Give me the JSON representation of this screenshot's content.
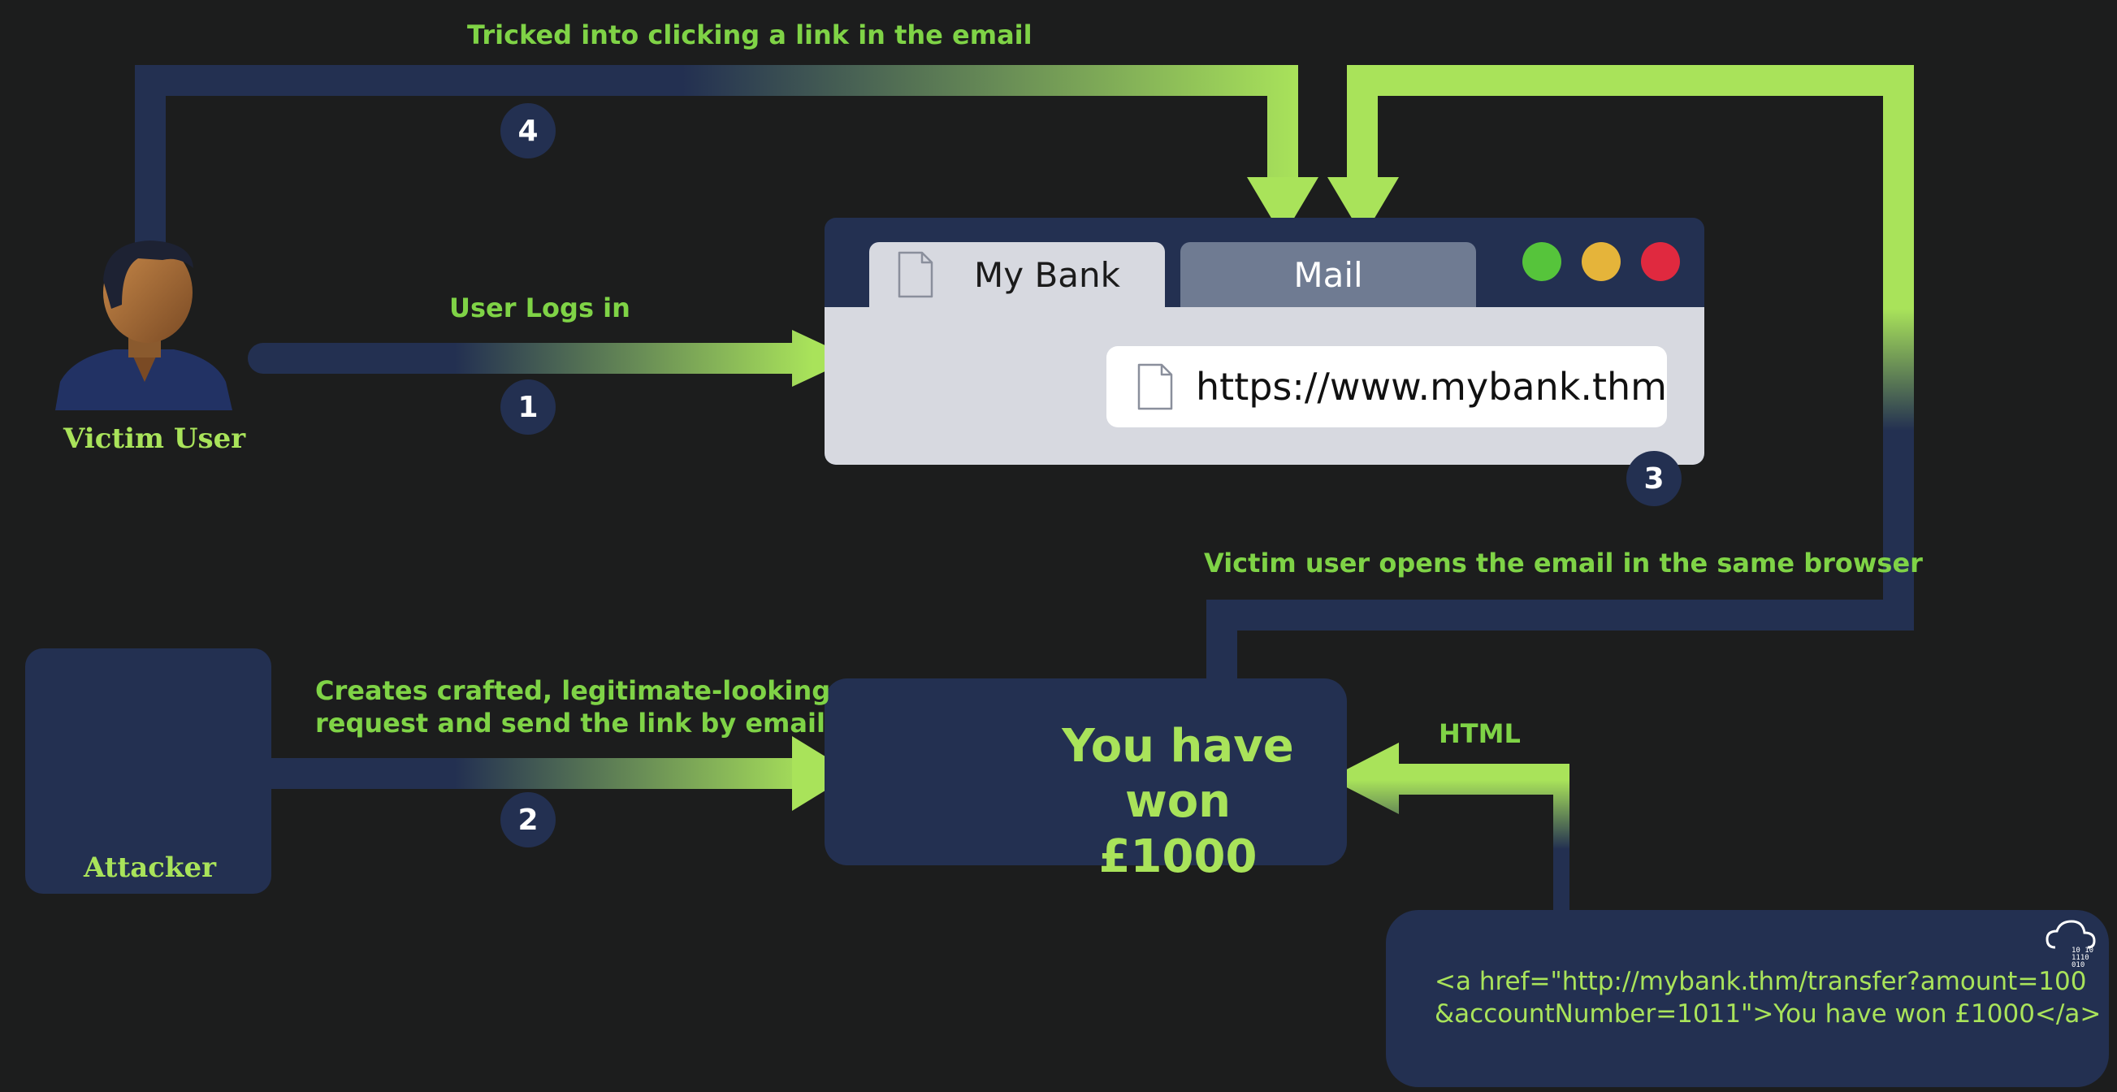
{
  "labels": {
    "step4": "Tricked into clicking a link in the email",
    "step1": "User Logs in",
    "step3": "Victim user opens the email in the same browser",
    "step2_line1": "Creates crafted, legitimate-looking",
    "step2_line2": "request and send the link by email",
    "html": "HTML"
  },
  "numbers": {
    "one": "1",
    "two": "2",
    "three": "3",
    "four": "4"
  },
  "actors": {
    "victim": "Victim User",
    "attacker": "Attacker"
  },
  "browser": {
    "tab1": "My Bank",
    "tab2": "Mail",
    "url": "https://www.mybank.thm",
    "dot_colors": [
      "#56c43b",
      "#e5b43a",
      "#e0293f"
    ]
  },
  "email": {
    "line1": "You have won",
    "line2": "£1000"
  },
  "code": {
    "line1": "<a href=\"http://mybank.thm/transfer?amount=100",
    "line2": "&accountNumber=1011\">You have won £1000</a>"
  },
  "colors": {
    "background": "#1c1d1d",
    "navy": "#233051",
    "accent": "#a9e35a",
    "label_green": "#7fd346"
  }
}
